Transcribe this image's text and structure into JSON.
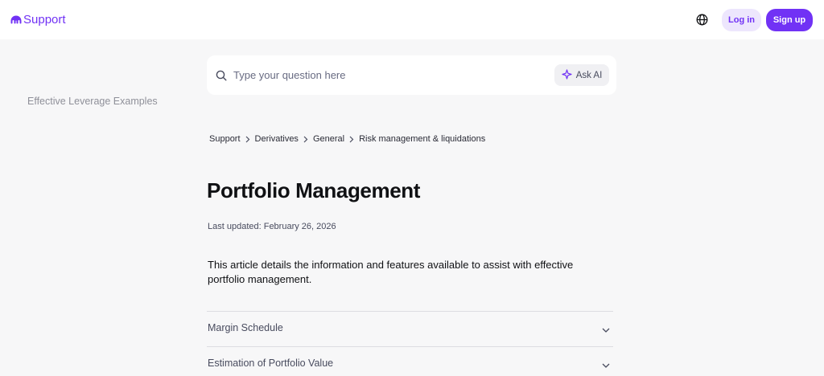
{
  "header": {
    "logo_text": "Support",
    "login_label": "Log in",
    "signup_label": "Sign up",
    "brand_color": "#7132f5"
  },
  "sidebar": {
    "items": [
      {
        "label": "Effective Leverage Examples"
      }
    ]
  },
  "search": {
    "placeholder": "Type your question here",
    "value": "",
    "ask_ai_label": "Ask AI"
  },
  "breadcrumb": [
    {
      "label": "Support"
    },
    {
      "label": "Derivatives"
    },
    {
      "label": "General"
    },
    {
      "label": "Risk management & liquidations"
    }
  ],
  "article": {
    "title": "Portfolio Management",
    "last_updated": "Last updated: February 26, 2026",
    "intro": "This article details the information and features available to assist with effective portfolio management.",
    "sections": [
      {
        "label": "Margin Schedule",
        "icon": "chevron-down-icon"
      },
      {
        "label": "Estimation of Portfolio Value",
        "icon": "chevron-down-icon"
      }
    ]
  }
}
